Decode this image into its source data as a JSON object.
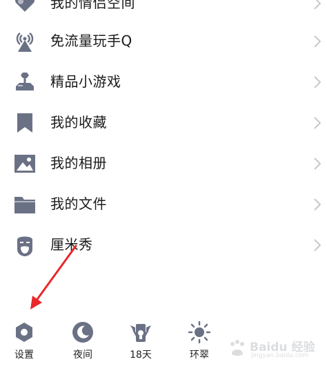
{
  "menu": {
    "items": [
      {
        "label": "我的情侣空间",
        "icon": "heart-couple-icon"
      },
      {
        "label": "免流量玩手Q",
        "icon": "signal-tower-icon"
      },
      {
        "label": "精品小游戏",
        "icon": "joystick-icon"
      },
      {
        "label": "我的收藏",
        "icon": "bookmark-icon"
      },
      {
        "label": "我的相册",
        "icon": "image-icon"
      },
      {
        "label": "我的文件",
        "icon": "folder-icon"
      },
      {
        "label": "厘米秀",
        "icon": "bearded-face-icon"
      }
    ]
  },
  "bottom_bar": {
    "items": [
      {
        "label": "设置",
        "icon": "settings-hexagon-icon"
      },
      {
        "label": "夜间",
        "icon": "moon-icon"
      },
      {
        "label": "18天",
        "icon": "weather-icon"
      },
      {
        "label": "环翠",
        "icon": "sun-icon"
      }
    ]
  },
  "watermark": {
    "text": "Baidu 经验",
    "sub": "jingyan.baidu.com"
  },
  "colors": {
    "icon": "#6b7185",
    "chevron": "#c8c8cc",
    "arrow": "#e8282a",
    "text": "#1a1a1a"
  }
}
